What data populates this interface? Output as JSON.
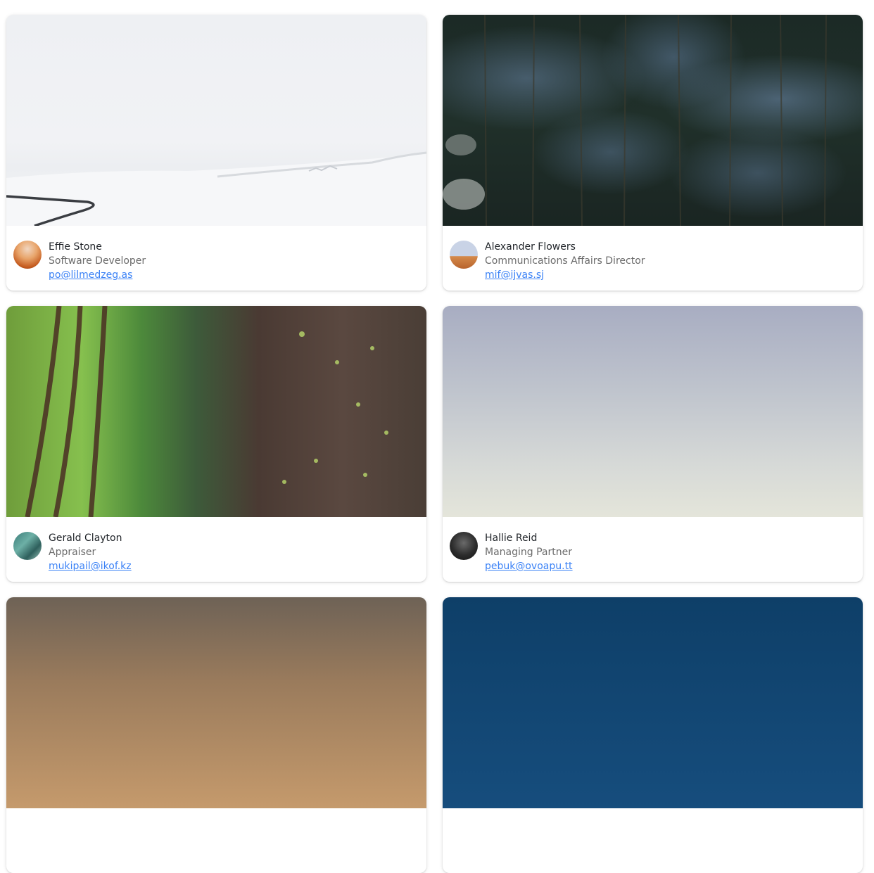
{
  "cards": [
    {
      "name": "Effie Stone",
      "title": "Software Developer",
      "email": "po@lilmedzeg.as",
      "photo_icon": "snowy-road-photo",
      "avatar_icon": "avatar-photo"
    },
    {
      "name": "Alexander Flowers",
      "title": "Communications Affairs Director",
      "email": "mif@ijvas.sj",
      "photo_icon": "forest-photo",
      "avatar_icon": "avatar-photo"
    },
    {
      "name": "Gerald Clayton",
      "title": "Appraiser",
      "email": "mukipail@ikof.kz",
      "photo_icon": "green-trees-photo",
      "avatar_icon": "avatar-photo"
    },
    {
      "name": "Hallie Reid",
      "title": "Managing Partner",
      "email": "pebuk@ovoapu.tt",
      "photo_icon": "sky-photo",
      "avatar_icon": "avatar-photo"
    }
  ],
  "colors": {
    "link": "#3b82f6",
    "name_text": "#1f2328",
    "subtitle_text": "#6b6b6b",
    "card_background": "#ffffff"
  }
}
